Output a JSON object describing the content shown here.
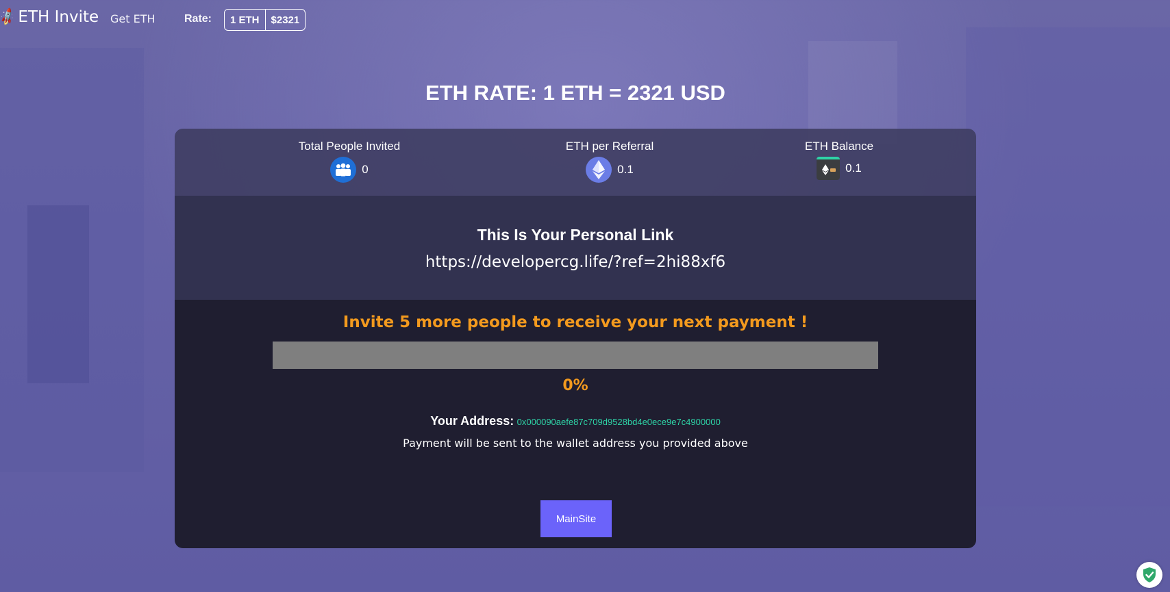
{
  "navbar": {
    "brand": "ETH Invite",
    "brand_icon": "rocket-icon",
    "get_eth_link": "Get ETH",
    "rate_label": "Rate:",
    "rate_unit": "1 ETH",
    "rate_value": "$2321"
  },
  "headline": "ETH RATE: 1 ETH = 2321 USD",
  "stats": {
    "invited": {
      "title": "Total People Invited",
      "value": "0",
      "icon": "people-icon"
    },
    "per_referral": {
      "title": "ETH per Referral",
      "value": "0.1",
      "icon": "ethereum-icon"
    },
    "balance": {
      "title": "ETH Balance",
      "value": "0.1",
      "icon": "wallet-icon"
    }
  },
  "personal_link": {
    "title": "This Is Your Personal Link",
    "url": "https://developercg.life/?ref=2hi88xf6"
  },
  "invite": {
    "message": "Invite 5 more people to receive your next payment !",
    "progress_percent": 0,
    "progress_label": "0%",
    "address_label": "Your Address:",
    "address_value": "0x000090aefe87c709d9528bd4e0ece9e7c4900000",
    "payment_note": "Payment will be sent to the wallet address you provided above",
    "button_label": "MainSite"
  },
  "colors": {
    "accent_orange": "#f39a1e",
    "address_green": "#2ed3a6",
    "button_purple": "#6b63fa",
    "background": "#6562a6"
  },
  "security_badge_icon": "shield-check-icon"
}
